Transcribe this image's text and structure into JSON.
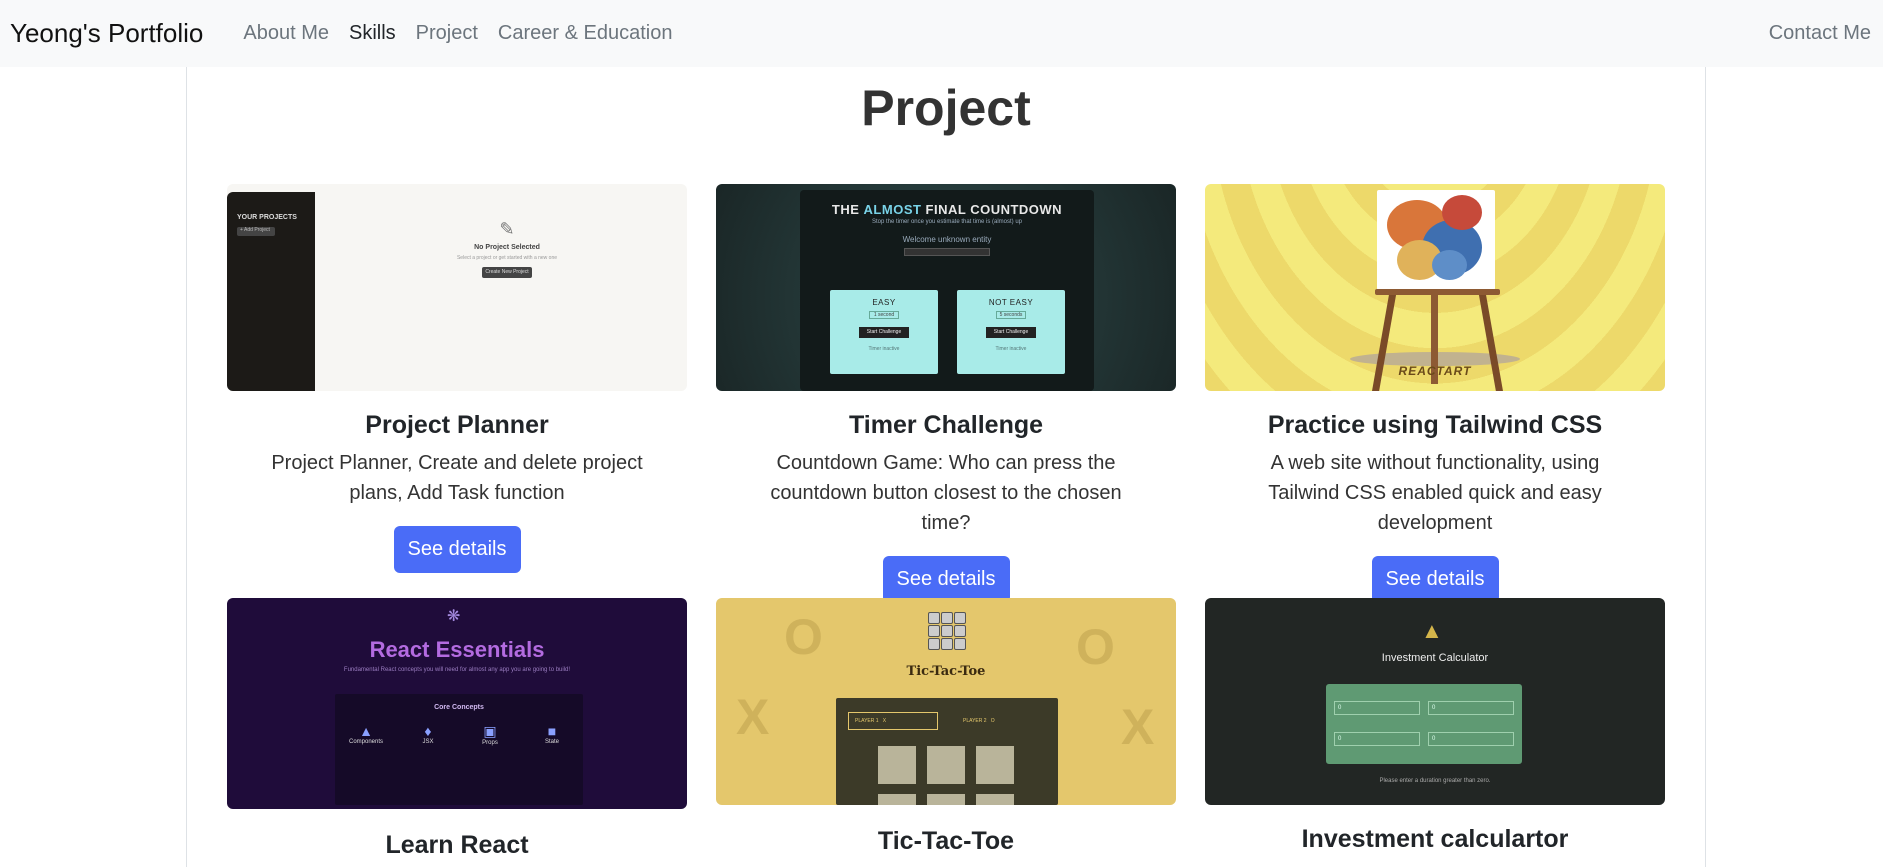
{
  "navbar": {
    "brand": "Yeong's Portfolio",
    "links": [
      "About Me",
      "Skills",
      "Project",
      "Career & Education"
    ],
    "active_index": 1,
    "contact": "Contact Me"
  },
  "section": {
    "title": "Project"
  },
  "projects": [
    {
      "title": "Project Planner",
      "desc": "Project Planner, Create and delete project plans, Add Task function",
      "button": "See details",
      "thumb": {
        "sidebar_title": "YOUR PROJECTS",
        "add_button": "+ Add Project",
        "heading": "No Project Selected",
        "subtext": "Select a project or get started with a new one",
        "cta": "Create New Project"
      }
    },
    {
      "title": "Timer Challenge",
      "desc": "Countdown Game: Who can press the countdown button closest to the chosen time?",
      "button": "See details",
      "thumb": {
        "title_prefix": "THE ",
        "title_accent": "ALMOST",
        "title_suffix": " FINAL COUNTDOWN",
        "subtitle": "Stop the timer once you estimate that time is (almost) up",
        "welcome": "Welcome unknown entity",
        "boxes": [
          {
            "label": "EASY",
            "time": "1 second",
            "button": "Start Challenge",
            "status": "Timer inactive"
          },
          {
            "label": "NOT EASY",
            "time": "5 seconds",
            "button": "Start Challenge",
            "status": "Timer inactive"
          }
        ]
      }
    },
    {
      "title": "Practice using Tailwind CSS",
      "desc": "A web site without functionality, using Tailwind CSS enabled quick and easy development",
      "button": "See details",
      "thumb": {
        "logo": "REACTART"
      }
    },
    {
      "title": "Learn React",
      "thumb": {
        "heading": "React Essentials",
        "subtext": "Fundamental React concepts you will need for almost any app you are going to build!",
        "panel_title": "Core Concepts",
        "concepts": [
          "Components",
          "JSX",
          "Props",
          "State"
        ]
      }
    },
    {
      "title": "Tic-Tac-Toe",
      "thumb": {
        "name": "Tic-Tac-Toe",
        "player1": "PLAYER 1",
        "player1_symbol": "X",
        "player2": "PLAYER 2",
        "player2_symbol": "O"
      }
    },
    {
      "title": "Investment calculartor",
      "thumb": {
        "heading": "Investment Calculator",
        "fields": [
          "0",
          "0",
          "0",
          "0"
        ],
        "message": "Please enter a duration greater than zero."
      }
    }
  ]
}
